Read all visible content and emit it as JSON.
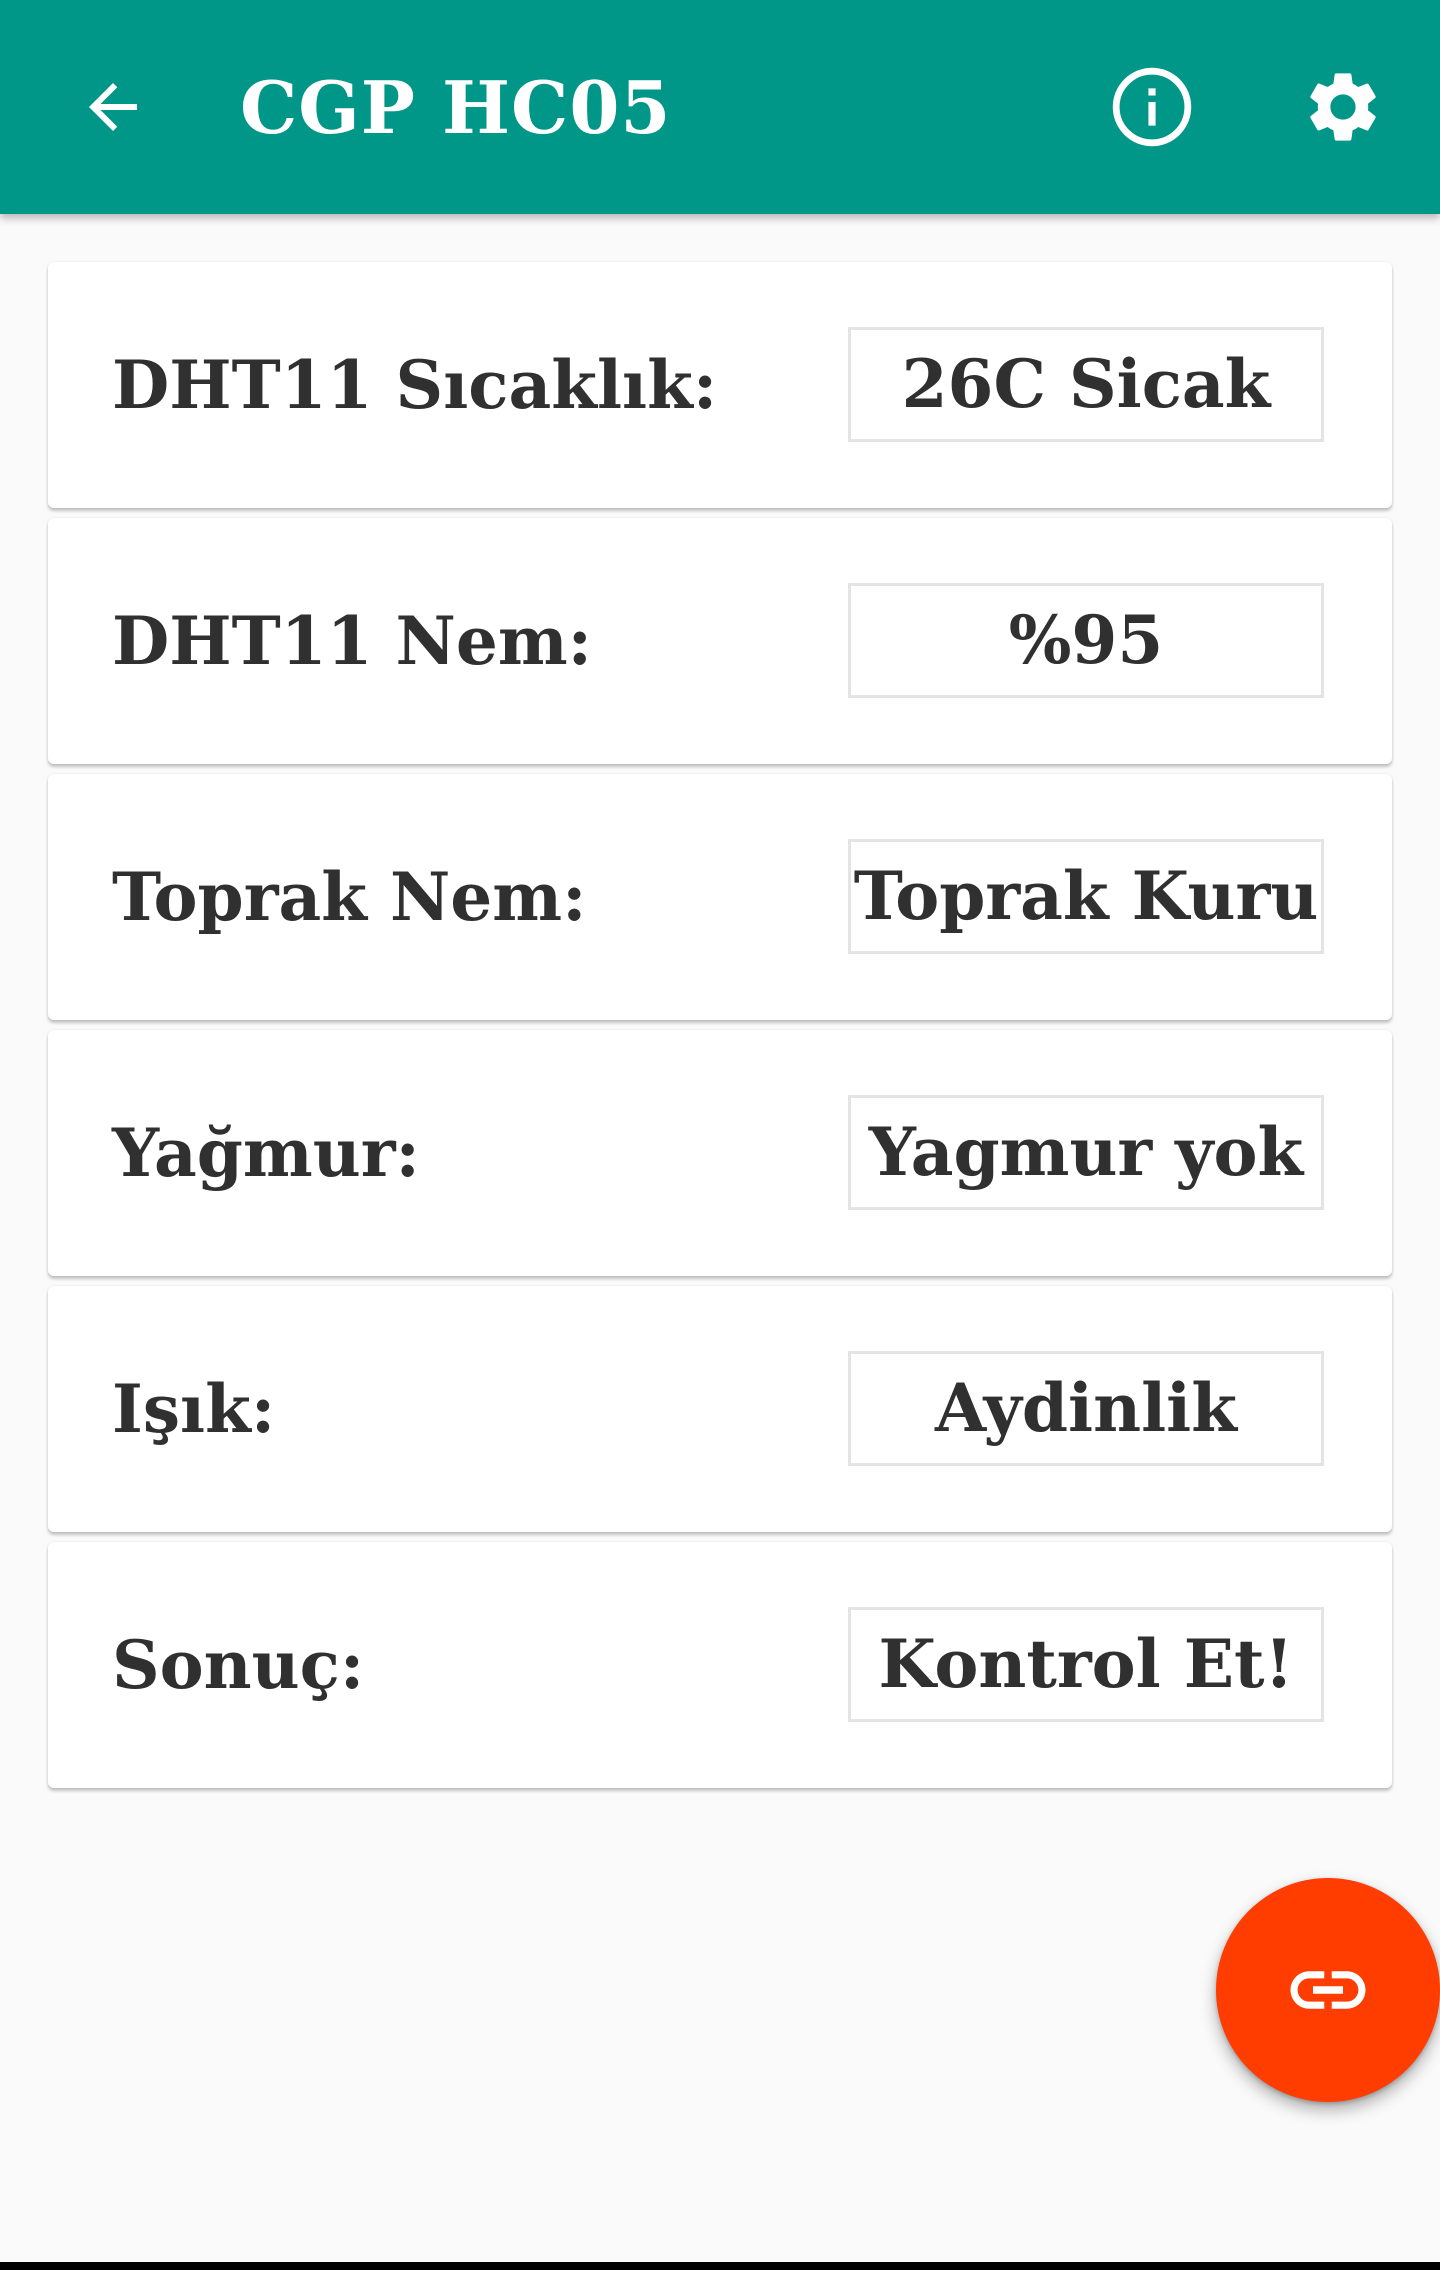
{
  "appbar": {
    "title": "CGP HC05",
    "background_color": "#009688",
    "back_icon": "arrow-back-icon",
    "info_icon": "info-icon",
    "settings_icon": "gear-icon"
  },
  "readings": [
    {
      "label": "DHT11 Sıcaklık:",
      "value": "26C Sicak"
    },
    {
      "label": "DHT11 Nem:",
      "value": "%95"
    },
    {
      "label": "Toprak Nem:",
      "value": "Toprak Kuru"
    },
    {
      "label": "Yağmur:",
      "value": "Yagmur yok"
    },
    {
      "label": "Işık:",
      "value": "Aydinlik"
    },
    {
      "label": "Sonuç:",
      "value": "Kontrol Et!"
    }
  ],
  "fab": {
    "icon": "link-icon",
    "color": "#ff3d00"
  }
}
